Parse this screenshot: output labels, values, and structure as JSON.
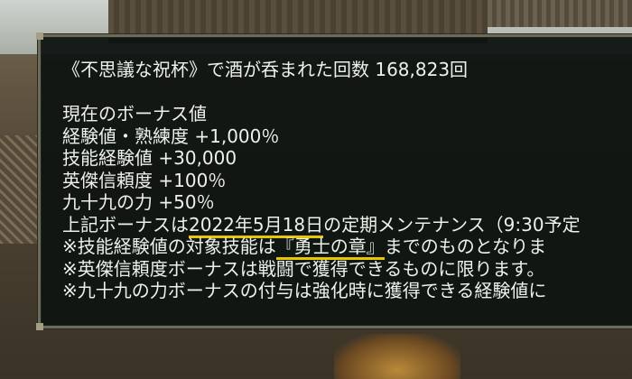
{
  "message": {
    "count_line": "《不思議な祝杯》で酒が呑まれた回数 168,823回",
    "bonus_heading": "現在のボーナス値",
    "bonuses": [
      "経験値・熟練度 +1,000％",
      "技能経験値 +30,000",
      "英傑信頼度 +100％",
      "九十九の力 +50％"
    ],
    "note1_prefix": "上記ボーナスは",
    "note1_date": "2022年5月18日",
    "note1_suffix": "の定期メンテナンス（9:30予定",
    "note2_prefix": "※技能経験値の対象技能は",
    "note2_skill": "『勇士の章』",
    "note2_suffix": "までのものとなりま",
    "note3": "※英傑信頼度ボーナスは戦闘で獲得できるものに限ります。",
    "note4": "※九十九の力ボーナスの付与は強化時に獲得できる経験値に"
  },
  "colors": {
    "panel_bg": "#0e1411",
    "text": "#eef0ea",
    "underline": "#e8c600",
    "border": "#6d6a58"
  }
}
